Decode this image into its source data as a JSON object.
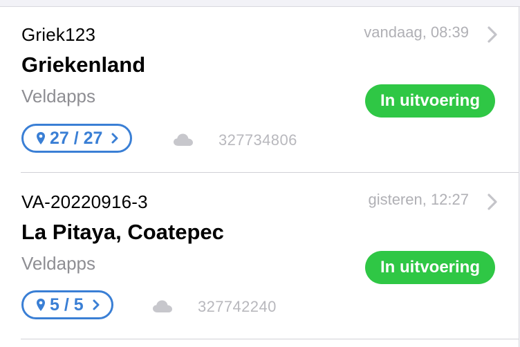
{
  "colors": {
    "status_green": "#2fc745",
    "location_blue": "#3a7fd5",
    "muted_gray": "#8e8e93"
  },
  "rows": [
    {
      "code": "Griek123",
      "name": "Griekenland",
      "company": "Veldapps",
      "timestamp": "vandaag, 08:39",
      "status": "In uitvoering",
      "locations": "27 / 27",
      "order_number": "327734806",
      "icons": [
        "location-pin-icon",
        "chevron-right-icon",
        "cloud-icon"
      ]
    },
    {
      "code": "VA-20220916-3",
      "name": "La Pitaya, Coatepec",
      "company": "Veldapps",
      "timestamp": "gisteren, 12:27",
      "status": "In uitvoering",
      "locations": "5 / 5",
      "order_number": "327742240",
      "icons": [
        "location-pin-icon",
        "chevron-right-icon",
        "cloud-icon"
      ]
    }
  ]
}
